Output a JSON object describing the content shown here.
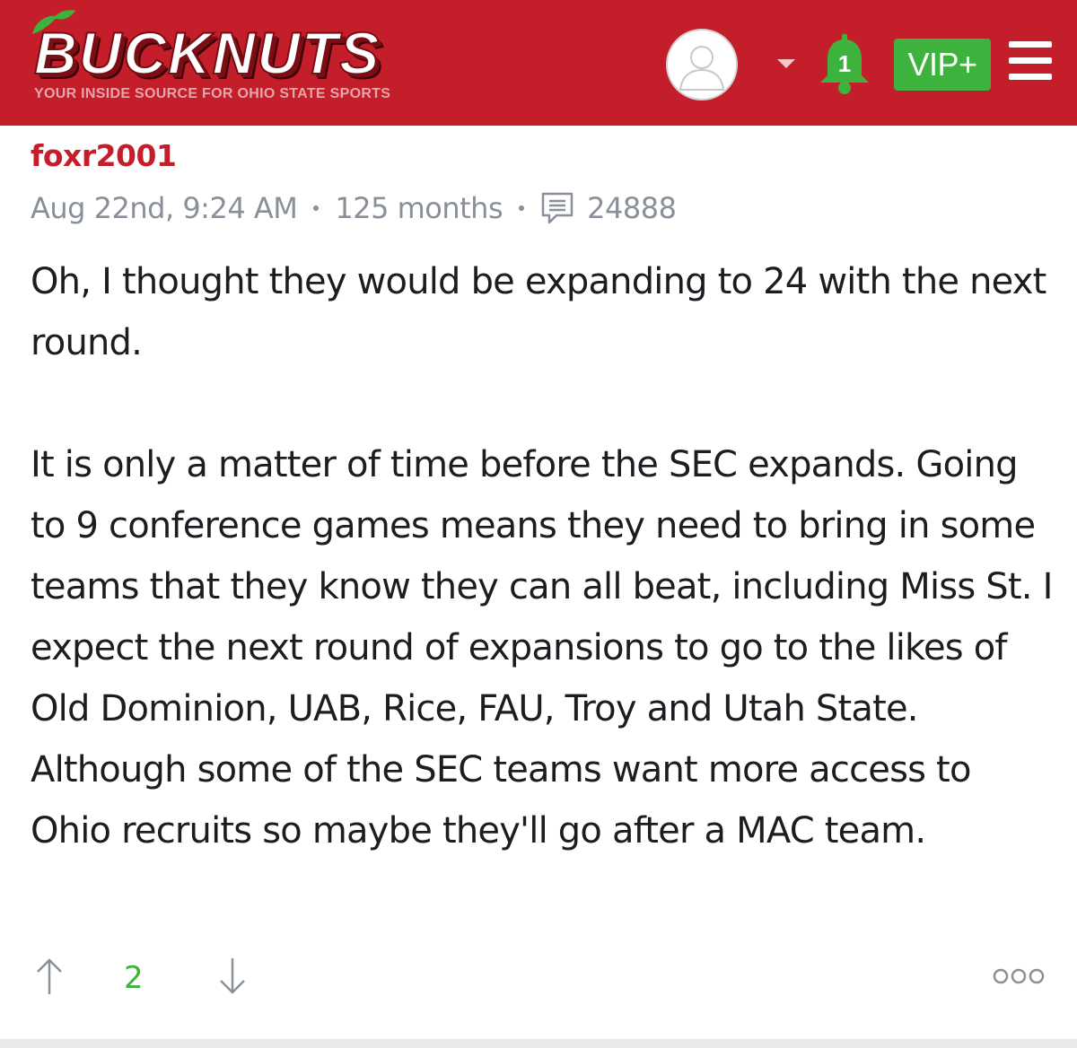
{
  "header": {
    "logo_text": "BUCKNUTS",
    "tagline": "YOUR INSIDE SOURCE FOR OHIO STATE SPORTS",
    "notification_count": "1",
    "vip_label": "VIP+",
    "brand_color": "#c41e2a",
    "accent_green": "#3db33d"
  },
  "post": {
    "author": "foxr2001",
    "timestamp": "Aug 22nd, 9:24 AM",
    "tenure": "125 months",
    "post_count": "24888",
    "paragraphs": [
      "Oh, I thought they would be expanding to 24 with the next round.",
      "It is only a matter of time before the SEC expands. Going to 9 conference games means they need to bring in some teams that they know they can all beat, including Miss St. I expect the next round of expansions to go to the likes of Old Dominion, UAB, Rice, FAU, Troy and Utah State. Although some of the SEC teams want more access to Ohio recruits so maybe they'll go after a MAC team."
    ]
  },
  "votes": {
    "score": "2"
  },
  "icons": [
    "avatar-placeholder-icon",
    "chevron-down-icon",
    "bell-icon",
    "hamburger-menu-icon",
    "comment-icon",
    "arrow-up-icon",
    "arrow-down-icon",
    "more-options-icon"
  ]
}
